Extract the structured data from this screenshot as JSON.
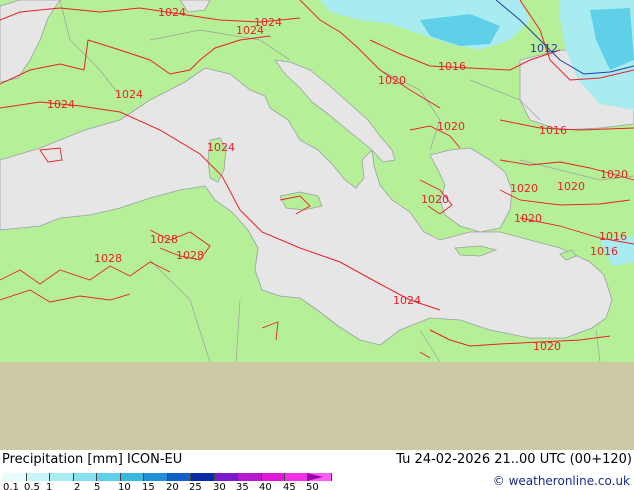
{
  "map": {
    "isobars": [
      "1024",
      "1024",
      "1024",
      "1024",
      "1024",
      "1024",
      "1028",
      "1028",
      "1028",
      "1024",
      "1020",
      "1020",
      "1016",
      "1012",
      "1016",
      "1020",
      "1020",
      "1020",
      "1020",
      "1020",
      "1016",
      "1016",
      "1020"
    ],
    "colors": {
      "land": "#b5f098",
      "sea": "#e6e6e6",
      "outside_domain": "#cccaa5",
      "isobar": "#e8202a",
      "isobar_low": "#2a3aa0",
      "border": "#9aa0a0",
      "precip_light": "#a8ecf2",
      "precip_medium": "#60d0e8"
    }
  },
  "footer": {
    "title_left": "Precipitation [mm]  ICON-EU",
    "title_right": "Tu 24-02-2026 21..00 UTC (00+120)",
    "credit": "© weatheronline.co.uk",
    "scale_labels": [
      "0.1",
      "0.5",
      "1",
      "2",
      "5",
      "10",
      "15",
      "20",
      "25",
      "30",
      "35",
      "40",
      "45",
      "50"
    ],
    "scale_colors": [
      "#e8fcff",
      "#c8f4fa",
      "#a8ecf2",
      "#88e0ee",
      "#60d0e8",
      "#38b8e0",
      "#2090d8",
      "#1060c8",
      "#0a2aa8",
      "#7a1acd",
      "#b81ad0",
      "#e018d8",
      "#f030e6",
      "#f860f0"
    ]
  }
}
